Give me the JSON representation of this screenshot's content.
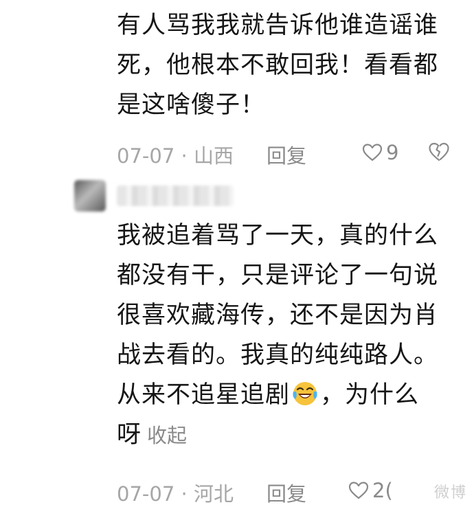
{
  "comment_1": {
    "lines": [
      "有人骂我我就告诉他谁造谣谁",
      "死，他根本不敢回我！看看都",
      "是这啥傻子！"
    ],
    "date": "07-07",
    "location": "山西",
    "reply_label": "回复",
    "like_count": "9"
  },
  "comment_2": {
    "username": "",
    "lines": [
      "我被追着骂了一天，真的什么",
      "都没有干，只是评论了一句说",
      "很喜欢藏海传，还不是因为肖",
      "战去看的。我真的纯纯路人。"
    ],
    "line5_before_emoji": "从来不追星追剧",
    "line5_after_emoji": "，为什么",
    "line6_text": "呀",
    "collapse_label": "收起",
    "date": "07-07",
    "location": "河北",
    "reply_label": "回复",
    "like_count": "2(",
    "emoji_name": "laughing-crying-face"
  },
  "watermark": "微博",
  "colors": {
    "text": "#161616",
    "meta": "#a6a6a6",
    "action": "#8a8a8a",
    "emoji_face": "#f6c33b"
  },
  "icons": [
    "heart-outline-icon",
    "broken-heart-icon"
  ]
}
